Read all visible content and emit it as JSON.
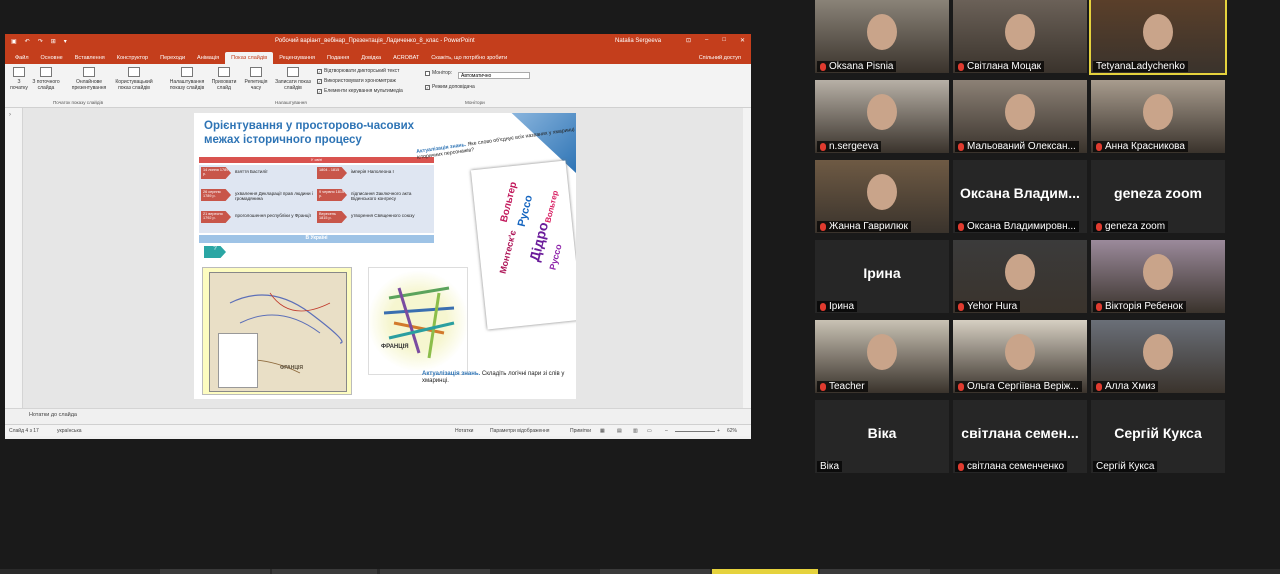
{
  "ppt": {
    "title": "Робочий варіант_вебінар_Презентація_Ладиченко_8_клас  -  PowerPoint",
    "user": "Natalia Sergeeva",
    "tabs": [
      "Файл",
      "Основне",
      "Вставлення",
      "Конструктор",
      "Переходи",
      "Анімація",
      "Показ слайдів",
      "Рецензування",
      "Подання",
      "Довідка",
      "ACROBAT",
      "Скажіть, що потрібно зробити"
    ],
    "active_tab": "Показ слайдів",
    "share": "Спільний доступ",
    "ribbon": {
      "from_start": "З початку",
      "from_current": "З поточного слайда",
      "online": "Онлайнове презентування",
      "custom": "Користувацький показ слайдів",
      "group1": "Початок показу слайдів",
      "setup": "Налаштування показу слайдів",
      "hide": "Приховати слайд",
      "rehearse": "Репетиція часу",
      "record": "Записати показ слайдів",
      "group2": "Налаштування",
      "chk1": "Відтворювати дикторський текст",
      "chk2": "Використовувати хронометраж",
      "chk3": "Елементи керування мультимедіа",
      "monitor_label": "Монітор:",
      "monitor_value": "Автоматично",
      "presenter": "Режим доповідача",
      "group3": "Монітори"
    },
    "slide": {
      "title": "Орієнтування у просторово-часових межах історичного процесу",
      "red_bar": "У світі",
      "events_left": [
        {
          "date": "14 липня 1789 р.",
          "text": "взяття Бастилії"
        },
        {
          "date": "26 серпня 1789 р.",
          "text": "ухвалення Декларації прав людини і громадянина"
        },
        {
          "date": "21 вересня 1792 р.",
          "text": "проголошення республіки у Франції"
        }
      ],
      "events_right": [
        {
          "date": "1804 - 1815",
          "text": "імперія Наполеона І"
        },
        {
          "date": "9 червня 1815 р.",
          "text": "підписання Заключного акта Віденського конгресу"
        },
        {
          "date": "Вересень 1815 р.",
          "text": "утворення Священного союзу"
        }
      ],
      "blue_bar": "В Україні",
      "q": "?",
      "map_label": "ФРАНЦІЯ",
      "cloud_label": "ФРАНЦІЯ",
      "callout1_bold": "Актуалізація знань.",
      "callout1_rest": "Яке слово об'єднує всіх названих у хмаринці історичних персонажів?",
      "card_words": [
        "Вольтер",
        "Руссо",
        "Дідро",
        "Монтеск'є",
        "Руссо",
        "Вольтер"
      ],
      "callout2_bold": "Актуалізація знань.",
      "callout2_rest": "Складіть логічні пари зі слів у хмаринці."
    },
    "notes": "Нотатки до слайда",
    "status": {
      "slide": "Слайд 4 з 17",
      "lang": "українська",
      "notes_btn": "Нотатки",
      "display": "Параметри відображення",
      "comments": "Примітки",
      "zoom": "62%"
    }
  },
  "participants": [
    {
      "name": "Oksana Pisnia",
      "muted": true,
      "big": "",
      "video": true
    },
    {
      "name": "Світлана Моцак",
      "muted": true,
      "big": "",
      "video": true
    },
    {
      "name": "TetyanaLadychenko",
      "muted": false,
      "big": "",
      "video": true,
      "active": true
    },
    {
      "name": "n.sergeeva",
      "muted": true,
      "big": "",
      "video": true
    },
    {
      "name": "Мальований Олексан...",
      "muted": true,
      "big": "",
      "video": true
    },
    {
      "name": "Анна Красникова",
      "muted": true,
      "big": "",
      "video": true
    },
    {
      "name": "Жанна Гаврилюк",
      "muted": true,
      "big": "",
      "video": true
    },
    {
      "name": "Оксана Владимировн...",
      "muted": true,
      "big": "Оксана Владим...",
      "video": false
    },
    {
      "name": "geneza zoom",
      "muted": true,
      "big": "geneza zoom",
      "video": false
    },
    {
      "name": "Ірина",
      "muted": true,
      "big": "Ірина",
      "video": false
    },
    {
      "name": "Yehor Hura",
      "muted": true,
      "big": "",
      "video": true
    },
    {
      "name": "Вікторія Ребенок",
      "muted": true,
      "big": "",
      "video": true
    },
    {
      "name": "Teacher",
      "muted": true,
      "big": "",
      "video": true
    },
    {
      "name": "Ольга Сергіївна Веріж...",
      "muted": true,
      "big": "",
      "video": true
    },
    {
      "name": "Алла Хмиз",
      "muted": true,
      "big": "",
      "video": true
    },
    {
      "name": "Віка",
      "muted": false,
      "big": "Віка",
      "video": false
    },
    {
      "name": "світлана семенченко",
      "muted": true,
      "big": "світлана семен...",
      "video": false
    },
    {
      "name": "Сергій Кукса",
      "muted": false,
      "big": "Сергій Кукса",
      "video": false
    }
  ]
}
